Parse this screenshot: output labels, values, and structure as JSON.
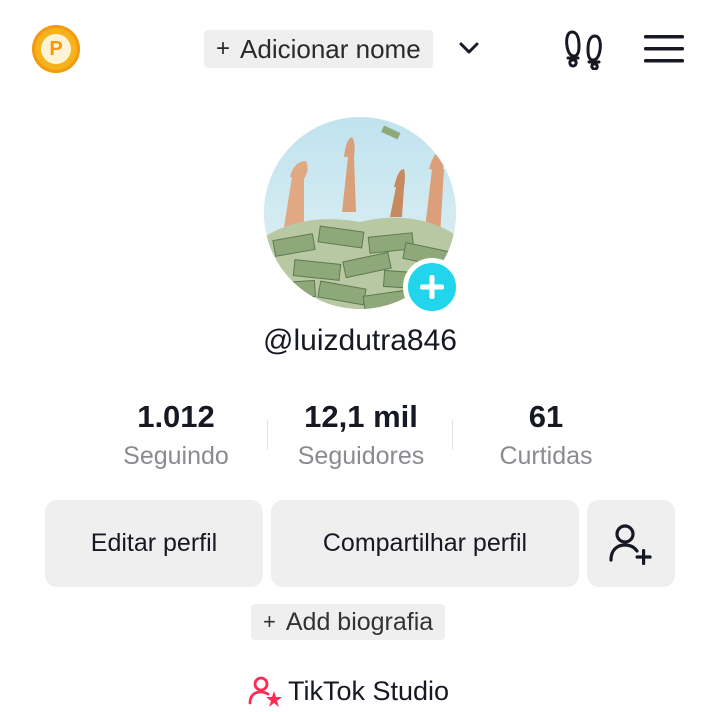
{
  "header": {
    "coin_letter": "P",
    "add_name_plus": "+",
    "add_name_label": "Adicionar nome"
  },
  "profile": {
    "username": "@luizdutra846"
  },
  "stats": [
    {
      "value": "1.012",
      "label": "Seguindo"
    },
    {
      "value": "12,1 mil",
      "label": "Seguidores"
    },
    {
      "value": "61",
      "label": "Curtidas"
    }
  ],
  "actions": {
    "edit_label": "Editar perfil",
    "share_label": "Compartilhar perfil"
  },
  "bio": {
    "plus": "+",
    "label": "Add biografia"
  },
  "studio": {
    "label": "TikTok Studio"
  },
  "colors": {
    "accent_cyan": "#20d5ec",
    "studio_icon": "#fe2c55",
    "coin": "#f6b21b"
  }
}
